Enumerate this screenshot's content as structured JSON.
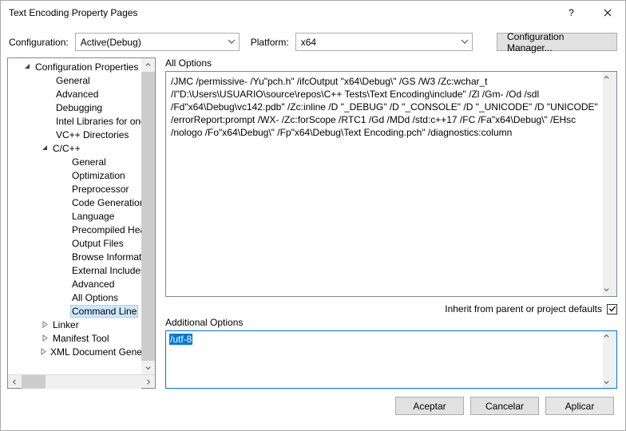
{
  "window": {
    "title": "Text Encoding Property Pages",
    "help": "?",
    "close": "×"
  },
  "top": {
    "config_label": "Configuration:",
    "config_value": "Active(Debug)",
    "platform_label": "Platform:",
    "platform_value": "x64",
    "cfg_manager": "Configuration Manager..."
  },
  "tree": {
    "root": "Configuration Properties",
    "items_l2": [
      "General",
      "Advanced",
      "Debugging",
      "Intel Libraries for oneAPI",
      "VC++ Directories"
    ],
    "cpp": "C/C++",
    "cpp_items": [
      "General",
      "Optimization",
      "Preprocessor",
      "Code Generation",
      "Language",
      "Precompiled Headers",
      "Output Files",
      "Browse Information",
      "External Includes",
      "Advanced",
      "All Options",
      "Command Line"
    ],
    "after": [
      "Linker",
      "Manifest Tool",
      "XML Document Generator"
    ]
  },
  "right": {
    "all_options_label": "All Options",
    "all_options_text": "/JMC /permissive- /Yu\"pch.h\" /ifcOutput \"x64\\Debug\\\" /GS /W3 /Zc:wchar_t /I\"D:\\Users\\USUARIO\\source\\repos\\C++ Tests\\Text Encoding\\include\" /Zl /Gm- /Od /sdl /Fd\"x64\\Debug\\vc142.pdb\" /Zc:inline /D \"_DEBUG\" /D \"_CONSOLE\" /D \"_UNICODE\" /D \"UNICODE\" /errorReport:prompt /WX- /Zc:forScope /RTC1 /Gd /MDd /std:c++17 /FC /Fa\"x64\\Debug\\\" /EHsc /nologo /Fo\"x64\\Debug\\\" /Fp\"x64\\Debug\\Text Encoding.pch\" /diagnostics:column",
    "inherit_label": "Inherit from parent or project defaults",
    "inherit_checked": true,
    "additional_label": "Additional Options",
    "additional_value": "/utf-8"
  },
  "buttons": {
    "ok": "Aceptar",
    "cancel": "Cancelar",
    "apply": "Aplicar"
  }
}
